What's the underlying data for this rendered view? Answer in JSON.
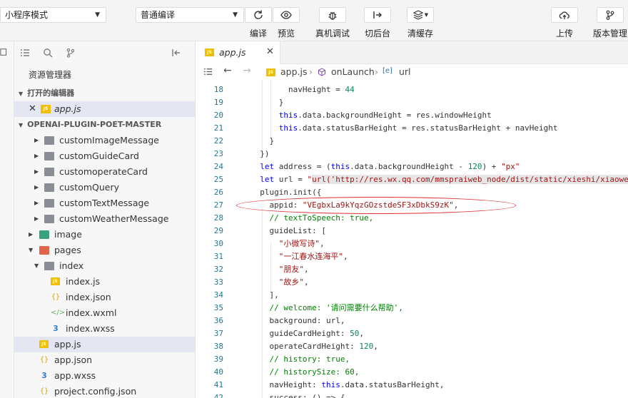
{
  "toolbar": {
    "mode_select": "小程序模式",
    "compile_select": "普通编译",
    "buttons": [
      {
        "id": "compile",
        "label": "编译",
        "icon": "refresh-icon"
      },
      {
        "id": "preview",
        "label": "预览",
        "icon": "eye-icon"
      },
      {
        "id": "debug",
        "label": "真机调试",
        "icon": "bug-icon"
      },
      {
        "id": "background",
        "label": "切后台",
        "icon": "switch-background-icon"
      },
      {
        "id": "clearcache",
        "label": "清缓存",
        "icon": "layers-icon"
      },
      {
        "id": "upload",
        "label": "上传",
        "icon": "cloud-upload-icon"
      },
      {
        "id": "version",
        "label": "版本管理",
        "icon": "branch-icon"
      }
    ]
  },
  "sidebar": {
    "title": "资源管理器",
    "open_editors_header": "打开的编辑器",
    "open_file": "app.js",
    "project_header": "OPENAI-PLUGIN-POET-MASTER",
    "tree": [
      {
        "name": "customImageMessage",
        "type": "folder"
      },
      {
        "name": "customGuideCard",
        "type": "folder"
      },
      {
        "name": "customoperateCard",
        "type": "folder"
      },
      {
        "name": "customQuery",
        "type": "folder"
      },
      {
        "name": "customTextMessage",
        "type": "folder"
      },
      {
        "name": "customWeatherMessage",
        "type": "folder"
      },
      {
        "name": "image",
        "type": "folder"
      },
      {
        "name": "pages",
        "type": "folder"
      },
      {
        "name": "index",
        "type": "folder"
      },
      {
        "name": "index.js",
        "type": "js"
      },
      {
        "name": "index.json",
        "type": "json"
      },
      {
        "name": "index.wxml",
        "type": "wxml"
      },
      {
        "name": "index.wxss",
        "type": "css"
      },
      {
        "name": "app.js",
        "type": "js"
      },
      {
        "name": "app.json",
        "type": "json"
      },
      {
        "name": "app.wxss",
        "type": "css"
      },
      {
        "name": "project.config.json",
        "type": "json"
      }
    ]
  },
  "editor": {
    "tab_name": "app.js",
    "breadcrumb": [
      "app.js",
      "onLaunch",
      "url"
    ],
    "first_line": 18,
    "lines": [
      "        navHeight = 44",
      "      }",
      "      this.data.backgroundHeight = res.windowHeight",
      "      this.data.statusBarHeight = res.statusBarHeight + navHeight",
      "    }",
      "  })",
      "  let address = (this.data.backgroundHeight - 120) + \"px\"",
      "  let url = \"url('http://res.wx.qq.com/mmspraiweb_node/dist/static/xieshi/xiaowe",
      "  plugin.init({",
      "    appid: \"VEgbxLa9kYqzGOzstdeSF3xDbkS9zK\",",
      "    // textToSpeech: true,",
      "    guideList: [",
      "      \"小微写诗\",",
      "      \"一江春水连海平\",",
      "      \"朋友\",",
      "      \"故乡\",",
      "    ],",
      "    // welcome: '请问需要什么帮助',",
      "    background: url,",
      "    guideCardHeight: 50,",
      "    operateCardHeight: 120,",
      "    // history: true,",
      "    // historySize: 60,",
      "    navHeight: this.data.statusBarHeight,",
      "    success: () => {"
    ]
  }
}
